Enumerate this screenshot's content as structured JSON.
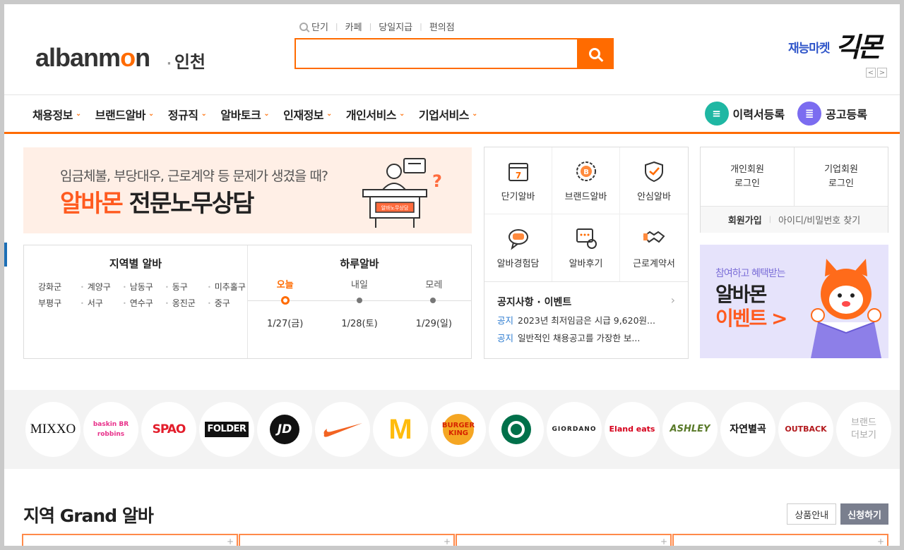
{
  "header": {
    "logo_text_a": "alba",
    "logo_text_o": "o",
    "logo_text_b": "n",
    "logo_text_m": "m",
    "region": "인천",
    "quick_links": [
      "단기",
      "카페",
      "당일지급",
      "편의점"
    ],
    "search_placeholder": "",
    "promo_small": "재능마켓",
    "promo_big": "긱몬",
    "promo_prev": "<",
    "promo_next": ">"
  },
  "nav": {
    "items": [
      "채용정보",
      "브랜드알바",
      "정규직",
      "알바토크",
      "인재정보",
      "개인서비스",
      "기업서비스"
    ],
    "resume_button": "이력서등록",
    "post_button": "공고등록"
  },
  "banner": {
    "subtitle": "임금체불, 부당대우, 근로계약 등 문제가 생겼을 때?",
    "title_highlight": "알바몬",
    "title_rest": " 전문노무상담",
    "sign": "알바노무상담"
  },
  "region_panel": {
    "title": "지역별 알바",
    "regions": [
      "강화군",
      "계양구",
      "남동구",
      "동구",
      "미추홀구",
      "부평구",
      "서구",
      "연수구",
      "옹진군",
      "중구"
    ]
  },
  "daily_panel": {
    "title": "하루알바",
    "days": [
      "오늘",
      "내일",
      "모레"
    ],
    "dates": [
      "1/27(금)",
      "1/28(토)",
      "1/29(일)"
    ]
  },
  "services": {
    "items": [
      "단기알바",
      "브랜드알바",
      "안심알바",
      "알바경험담",
      "알바후기",
      "근로계약서"
    ],
    "notice_title": "공지사항 · 이벤트",
    "notices": [
      {
        "tag": "공지",
        "text": "2023년 최저임금은 시급 9,620원..."
      },
      {
        "tag": "공지",
        "text": "일반적인 채용공고를 가장한 보..."
      }
    ]
  },
  "login": {
    "personal_line1": "개인회원",
    "personal_line2": "로그인",
    "company_line1": "기업회원",
    "company_line2": "로그인",
    "signup": "회원가입",
    "find": "아이디/비밀번호 찾기"
  },
  "event_banner": {
    "subtitle": "참여하고 혜택받는",
    "title_line1": "알바몬",
    "title_line2": "이벤트 >"
  },
  "brands": {
    "items": [
      "MIXXO",
      "baskin BR robbins",
      "SPAO",
      "FOLDER",
      "JD",
      "",
      "M",
      "BURGER KING",
      "",
      "GIORDANO",
      "Eland eats",
      "ASHLEY",
      "자연별곡",
      "OUTBACK"
    ],
    "more_line1": "브랜드",
    "more_line2": "더보기"
  },
  "grand": {
    "title": "지역 Grand 알바",
    "info_button": "상품안내",
    "apply_button": "신청하기",
    "card_plus": "+"
  },
  "colors": {
    "accent": "#ff6b00",
    "notice_tag": "#2b7bd0",
    "promo_blue": "#2f55c9"
  }
}
